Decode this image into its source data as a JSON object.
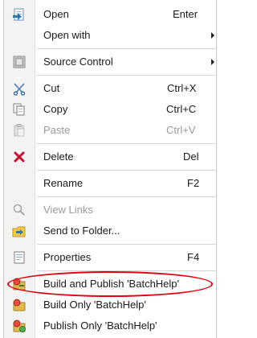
{
  "menu": {
    "items": [
      {
        "label": "Open",
        "shortcut": "Enter",
        "icon": "open-icon"
      },
      {
        "label": "Open with",
        "submenu": true
      },
      {
        "label": "Source Control",
        "submenu": true,
        "icon": "source-control-icon"
      },
      {
        "label": "Cut",
        "shortcut": "Ctrl+X",
        "icon": "scissors-icon"
      },
      {
        "label": "Copy",
        "shortcut": "Ctrl+C",
        "icon": "copy-icon"
      },
      {
        "label": "Paste",
        "shortcut": "Ctrl+V",
        "icon": "paste-icon",
        "disabled": true
      },
      {
        "label": "Delete",
        "shortcut": "Del",
        "icon": "delete-icon"
      },
      {
        "label": "Rename",
        "shortcut": "F2"
      },
      {
        "label": "View Links",
        "icon": "view-links-icon",
        "disabled": true
      },
      {
        "label": "Send to Folder...",
        "icon": "send-to-folder-icon"
      },
      {
        "label": "Properties",
        "shortcut": "F4",
        "icon": "properties-icon"
      },
      {
        "label": "Build and Publish 'BatchHelp'",
        "icon": "build-publish-icon",
        "highlighted": true
      },
      {
        "label": "Build Only 'BatchHelp'",
        "icon": "build-only-icon"
      },
      {
        "label": "Publish Only 'BatchHelp'",
        "icon": "publish-only-icon"
      }
    ]
  },
  "colors": {
    "highlight_ellipse": "#e4000f",
    "delete_red": "#c8102e",
    "accent_blue": "#2f73c8"
  }
}
